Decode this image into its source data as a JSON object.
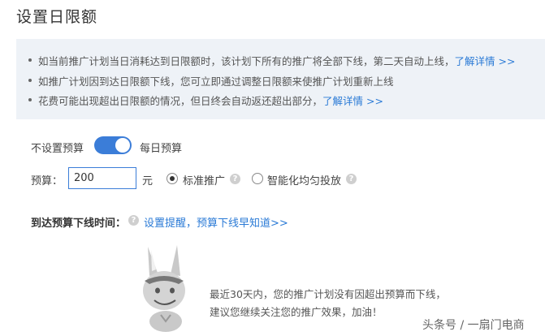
{
  "page": {
    "title": "设置日限额"
  },
  "notice": {
    "items": [
      {
        "text": "如当前推广计划当日消耗达到日限额时，该计划下所有的推广将全部下线，第二天自动上线，",
        "link": "了解详情 >>"
      },
      {
        "text": "如推广计划因到达日限额下线，您可立即通过调整日限额来使推广计划重新上线",
        "link": ""
      },
      {
        "text": "花费可能出现超出日限额的情况，但日终会自动返还超出部分，",
        "link": "了解详情 >>"
      }
    ]
  },
  "budget_mode": {
    "left_label": "不设置预算",
    "right_label": "每日预算",
    "enabled": true
  },
  "budget": {
    "label": "预算：",
    "value": "200",
    "unit": "元",
    "options": [
      {
        "label": "标准推广",
        "selected": true
      },
      {
        "label": "智能化均匀投放",
        "selected": false
      }
    ]
  },
  "offline_time": {
    "label": "到达预算下线时间：",
    "link_text": "设置提醒，预算下线早知道>>"
  },
  "empty_state": {
    "line1": "最近30天内，您的推广计划没有因超出预算而下线，",
    "line2": "建议您继续关注您的推广效果，加油！"
  },
  "watermark": "头条号 / 一扇门电商",
  "colors": {
    "accent": "#3b7dd8",
    "link": "#2a7ad6",
    "notice_bg": "#eef2f7"
  },
  "icons": [
    "help-icon",
    "mascot-illustration"
  ]
}
